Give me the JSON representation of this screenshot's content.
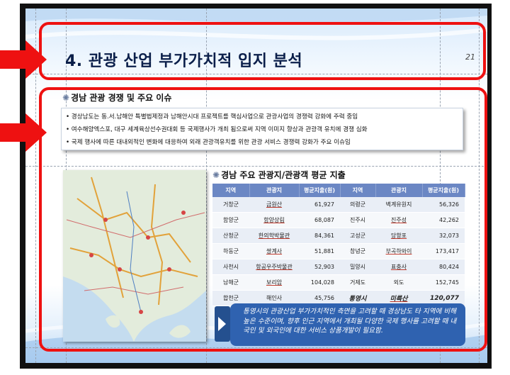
{
  "slide": {
    "title": "4. 관광 산업 부가가치적 입지 분석",
    "page_number": "21"
  },
  "section1": {
    "heading": "경남 관광 경쟁 및 주요 이슈",
    "bullets": [
      "• 경상남도는 동.서.남해안 특별법제정과 남해안시대 프로젝트를 핵심사업으로 관광사업의 경쟁력 강화에 주력 중임",
      "• 여수해양엑스포, 대구 세계육상선수권대회 등 국제행사가 개최 됨으로써 지역 이미지 향상과 관광객 유치에 경쟁 심화",
      "• 국제 행사에 따른 대내외적인 변화에 대응하여 외래 관광객유치를 위한 관광 서비스 경쟁력 강화가 주요 이슈임"
    ]
  },
  "section2": {
    "heading": "경남 주요 관광지/관광객 평균 지출",
    "headers": [
      "지역",
      "관광지",
      "평균지출(원)",
      "지역",
      "관광지",
      "평균지출(원)"
    ],
    "rows": [
      [
        "거창군",
        "금원산",
        "61,927",
        "의령군",
        "벽계유원지",
        "56,326"
      ],
      [
        "함양군",
        "함양상림",
        "68,087",
        "진주시",
        "진주성",
        "42,262"
      ],
      [
        "산청군",
        "한의학박물관",
        "84,361",
        "고성군",
        "당항포",
        "32,073"
      ],
      [
        "하동군",
        "쌍계사",
        "51,881",
        "창녕군",
        "부곡하와이",
        "173,417"
      ],
      [
        "사천시",
        "항공우주박물관",
        "52,903",
        "밀양시",
        "표충사",
        "80,424"
      ],
      [
        "남해군",
        "보리암",
        "104,028",
        "거제도",
        "외도",
        "152,745"
      ],
      [
        "합천군",
        "해인사",
        "45,756",
        "통영시",
        "미륵산",
        "120,077"
      ]
    ]
  },
  "callout": {
    "text": "통영시의 관광산업 부가가치적인 측면을 고려할 때 경상남도 타 지역에 비해 높은 수준이며, 향후 인근 지역에서 개최될 다양한 국제 행사를 고려할 때 내국인 및 외국인에 대한 서비스 상품개발이 필요함."
  },
  "colors": {
    "highlight": "#ee1111",
    "table_header": "#6b87c4",
    "callout_bg": "#2f62b0"
  }
}
